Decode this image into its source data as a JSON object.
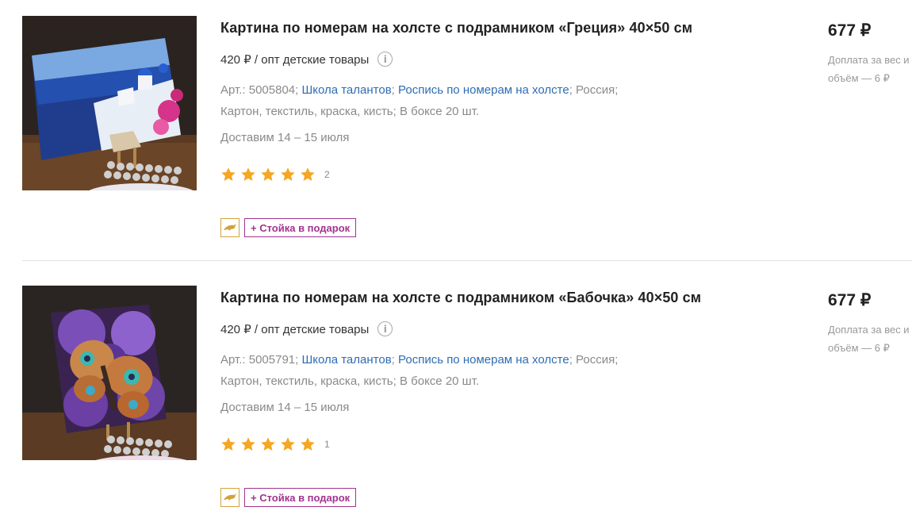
{
  "products": [
    {
      "title": "Картина по номерам на холсте с подрамником «Греция» 40×50 см",
      "wholesale_price": "420 ₽ / опт детские товары",
      "article": "Арт.: 5005804;",
      "brand": "Школа талантов",
      "category": "Роспись по номерам на холсте",
      "country": "Россия;",
      "materials": "Картон, текстиль, краска, кисть;",
      "box": "В боксе 20 шт.",
      "delivery": "Доставим 14 – 15 июля",
      "rating": 5,
      "reviews": "2",
      "promo": "+ Стойка в подарок",
      "price": "677 ₽",
      "surcharge": "Доплата за вес и объём — 6 ₽",
      "image": "greece-painting"
    },
    {
      "title": "Картина по номерам на холсте с подрамником «Бабочка» 40×50 см",
      "wholesale_price": "420 ₽ / опт детские товары",
      "article": "Арт.: 5005791;",
      "brand": "Школа талантов",
      "category": "Роспись по номерам на холсте",
      "country": "Россия;",
      "materials": "Картон, текстиль, краска, кисть;",
      "box": "В боксе 20 шт.",
      "delivery": "Доставим 14 – 15 июля",
      "rating": 5,
      "reviews": "1",
      "promo": "+ Стойка в подарок",
      "price": "677 ₽",
      "surcharge": "Доплата за вес и объём — 6 ₽",
      "image": "butterfly-painting"
    }
  ],
  "icons": {
    "info": "info-icon",
    "star": "star-icon",
    "dolphin": "dolphin-icon"
  },
  "colors": {
    "link": "#2e6db4",
    "star": "#f5a623",
    "promo": "#a3338f",
    "badge_border": "#d4a23a"
  }
}
